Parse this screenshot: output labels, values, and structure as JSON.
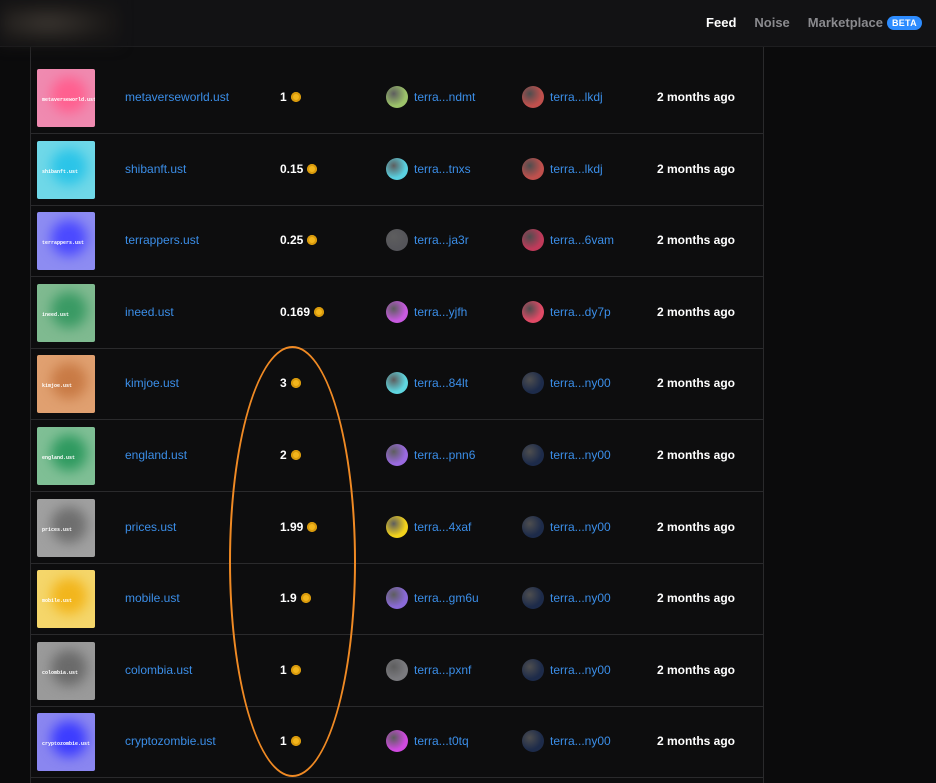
{
  "nav": {
    "feed": "Feed",
    "noise": "Noise",
    "marketplace": "Marketplace",
    "beta": "BETA"
  },
  "rows": [
    {
      "name": "metaverseworld.ust",
      "thumb_text": "metaverseworld.ust",
      "price": "1",
      "from": "terra...ndmt",
      "to": "terra...lkdj",
      "time": "2 months ago",
      "thumb_color": "#f08ab0",
      "orb": "#ff5f8f",
      "from_av": "#9cc26a",
      "to_av": "#c0504d"
    },
    {
      "name": "shibanft.ust",
      "thumb_text": "shibanft.ust",
      "price": "0.15",
      "from": "terra...tnxs",
      "to": "terra...lkdj",
      "time": "2 months ago",
      "thumb_color": "#6fd8e8",
      "orb": "#2bc4e8",
      "from_av": "#5ad0e0",
      "to_av": "#c0504d"
    },
    {
      "name": "terrappers.ust",
      "thumb_text": "terrappers.ust",
      "price": "0.25",
      "from": "terra...ja3r",
      "to": "terra...6vam",
      "time": "2 months ago",
      "thumb_color": "#8d8cf2",
      "orb": "#4b49ff",
      "from_av": "#55555a",
      "to_av": "#c03a5a"
    },
    {
      "name": "ineed.ust",
      "thumb_text": "ineed.ust",
      "price": "0.169",
      "from": "terra...yjfh",
      "to": "terra...dy7p",
      "time": "2 months ago",
      "thumb_color": "#7fba90",
      "orb": "#3a9a64",
      "from_av": "#c85ae0",
      "to_av": "#e04a66"
    },
    {
      "name": "kimjoe.ust",
      "thumb_text": "kimjoe.ust",
      "price": "3",
      "from": "terra...84lt",
      "to": "terra...ny00",
      "time": "2 months ago",
      "thumb_color": "#e0a070",
      "orb": "#c87a45",
      "from_av": "#5fd6e0",
      "to_av": "#1d2b4a"
    },
    {
      "name": "england.ust",
      "thumb_text": "england.ust",
      "price": "2",
      "from": "terra...pnn6",
      "to": "terra...ny00",
      "time": "2 months ago",
      "thumb_color": "#7fbf95",
      "orb": "#2f9a60",
      "from_av": "#9a6ae0",
      "to_av": "#1d2b4a"
    },
    {
      "name": "prices.ust",
      "thumb_text": "prices.ust",
      "price": "1.99",
      "from": "terra...4xaf",
      "to": "terra...ny00",
      "time": "2 months ago",
      "thumb_color": "#a0a0a0",
      "orb": "#6e6e6e",
      "from_av": "#f2d21c",
      "to_av": "#1d2b4a"
    },
    {
      "name": "mobile.ust",
      "thumb_text": "mobile.ust",
      "price": "1.9",
      "from": "terra...gm6u",
      "to": "terra...ny00",
      "time": "2 months ago",
      "thumb_color": "#f5d66a",
      "orb": "#f2b51c",
      "from_av": "#8a6ad8",
      "to_av": "#1d2b4a"
    },
    {
      "name": "colombia.ust",
      "thumb_text": "colombia.ust",
      "price": "1",
      "from": "terra...pxnf",
      "to": "terra...ny00",
      "time": "2 months ago",
      "thumb_color": "#9a9a9a",
      "orb": "#6a6a6a",
      "from_av": "#7a7a7e",
      "to_av": "#1d2b4a"
    },
    {
      "name": "cryptozombie.ust",
      "thumb_text": "cryptozombie.ust",
      "price": "1",
      "from": "terra...t0tq",
      "to": "terra...ny00",
      "time": "2 months ago",
      "thumb_color": "#8a86f0",
      "orb": "#3c3cff",
      "from_av": "#d04ae0",
      "to_av": "#1d2b4a"
    }
  ]
}
